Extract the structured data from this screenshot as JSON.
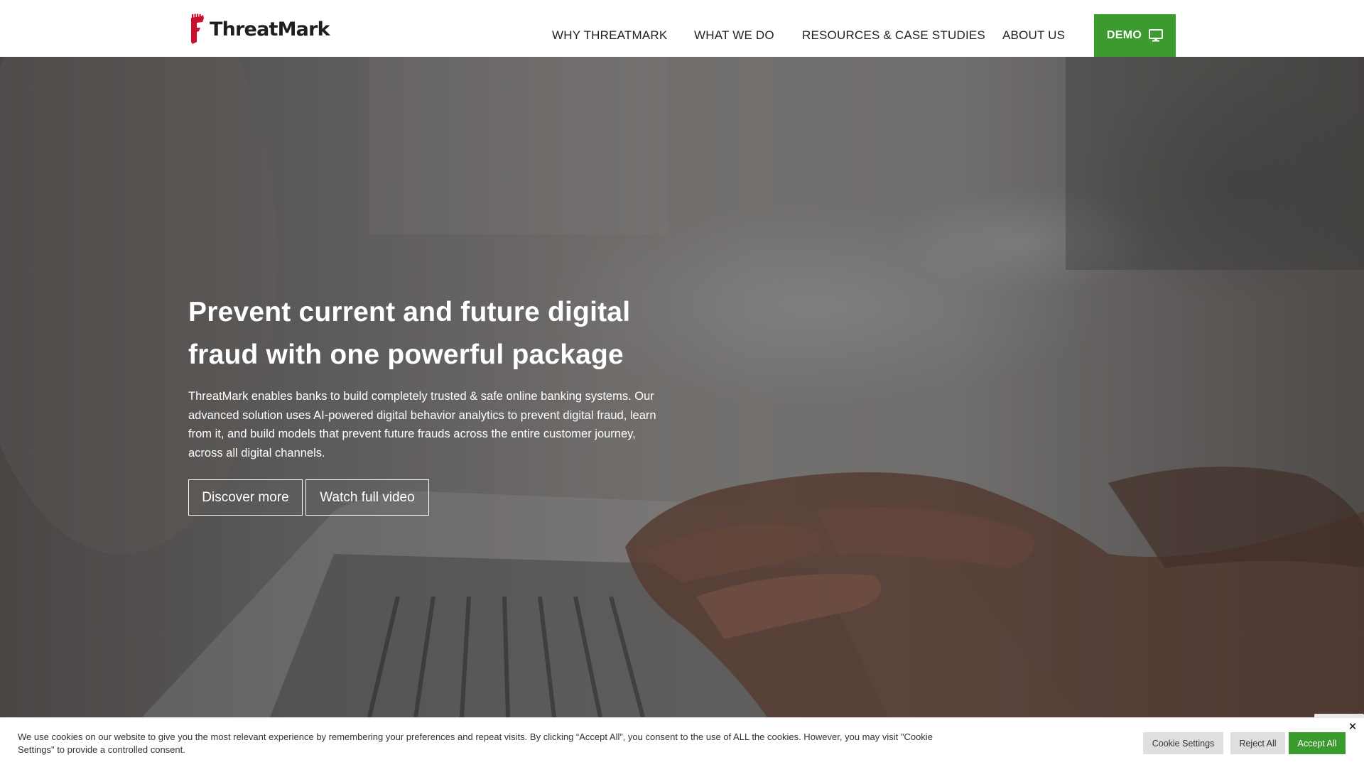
{
  "header": {
    "logo": {
      "text": "ThreatMark",
      "mark_color": "#c8102e"
    },
    "nav": [
      {
        "label": "WHY THREATMARK"
      },
      {
        "label": "WHAT WE DO"
      },
      {
        "label": "RESOURCES & CASE STUDIES"
      },
      {
        "label": "ABOUT US"
      }
    ],
    "demo_button": {
      "label": "DEMO",
      "icon": "monitor-icon",
      "color": "#3b9b2e"
    }
  },
  "hero": {
    "title": "Prevent current and future digital fraud with one powerful package",
    "description": "ThreatMark enables banks to build completely trusted & safe online banking systems. Our advanced solution uses AI-powered digital behavior analytics to prevent digital fraud, learn from it, and build models that prevent future frauds across the entire customer journey, across all digital channels.",
    "buttons": [
      {
        "label": "Discover more"
      },
      {
        "label": "Watch full video"
      }
    ],
    "background": "photo of hands typing on a laptop keyboard"
  },
  "cookie_bar": {
    "text": "We use cookies on our website to give you the most relevant experience by remembering your preferences and repeat visits. By clicking “Accept All”, you consent to the use of ALL the cookies. However, you may visit \"Cookie Settings\" to provide a controlled consent.",
    "settings_label": "Cookie Settings",
    "reject_label": "Reject All",
    "accept_label": "Accept All",
    "close_label": "✕",
    "accept_color": "#3b9b2e"
  }
}
